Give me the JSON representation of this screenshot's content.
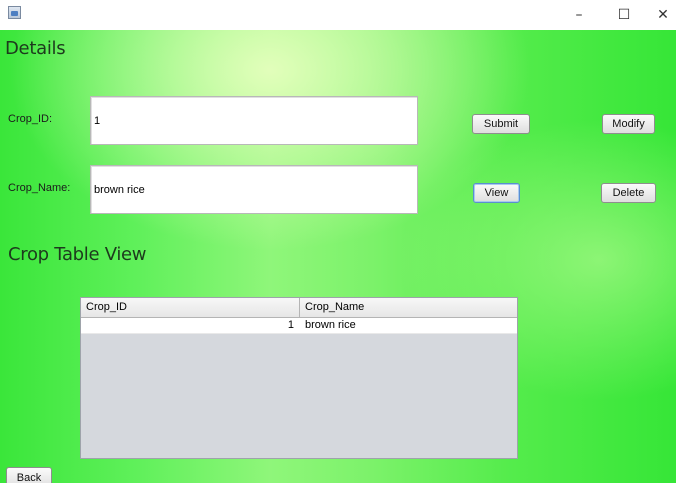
{
  "window": {
    "controls": {
      "minimize": "–",
      "maximize": "☐",
      "close": "✕"
    }
  },
  "form": {
    "title": "Details",
    "crop_id": {
      "label": "Crop_ID:",
      "value": "1"
    },
    "crop_name": {
      "label": "Crop_Name:",
      "value": "brown rice"
    },
    "buttons": {
      "submit": "Submit",
      "modify": "Modify",
      "view": "View",
      "delete": "Delete"
    }
  },
  "table_section": {
    "title": "Crop Table View",
    "columns": [
      "Crop_ID",
      "Crop_Name"
    ],
    "rows": [
      {
        "crop_id": "1",
        "crop_name": "brown rice"
      }
    ]
  },
  "footer": {
    "back": "Back"
  }
}
